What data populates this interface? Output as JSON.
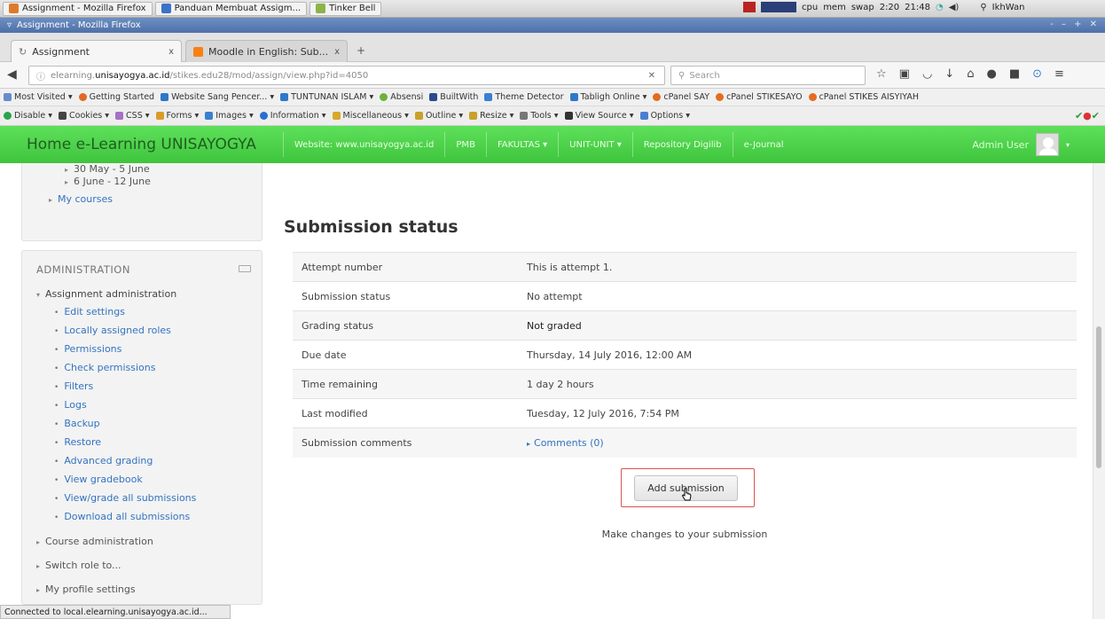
{
  "taskbar": {
    "items": [
      "Assignment - Mozilla Firefox",
      "Panduan Membuat Assigm...",
      "Tinker Bell"
    ],
    "sysinfo": [
      "cpu",
      "mem",
      "swap",
      "2:20",
      "21:48"
    ],
    "user": "IkhWan"
  },
  "window": {
    "title": "Assignment - Mozilla Firefox"
  },
  "tabs": [
    {
      "label": "Assignment",
      "active": true
    },
    {
      "label": "Moodle in English: Sub...",
      "active": false
    }
  ],
  "tab_close_glyph": "x",
  "new_tab_glyph": "+",
  "address": {
    "prefix": "elearning.",
    "domain": "unisayogya.ac.id",
    "path": "/stikes.edu28/mod/assign/view.php?id=4050",
    "search_placeholder": "Search"
  },
  "bookmarks": [
    "Most Visited",
    "Getting Started",
    "Website Sang Pencer...",
    "TUNTUNAN ISLAM",
    "Absensi",
    "BuiltWith",
    "Theme Detector",
    "Tabligh Online",
    "cPanel SAY",
    "cPanel STIKESAYO",
    "cPanel STIKES AISYIYAH"
  ],
  "devtools": [
    "Disable",
    "Cookies",
    "CSS",
    "Forms",
    "Images",
    "Information",
    "Miscellaneous",
    "Outline",
    "Resize",
    "Tools",
    "View Source",
    "Options"
  ],
  "moodle_nav": {
    "brand": "Home e-Learning UNISAYOGYA",
    "items": [
      "Website: www.unisayogya.ac.id",
      "PMB",
      "FAKULTAS",
      "UNIT-UNIT",
      "Repository Digilib",
      "e-Journal"
    ],
    "user": "Admin User"
  },
  "sidebar_top": {
    "items": [
      "30 May - 5 June",
      "6 June - 12 June",
      "My courses"
    ]
  },
  "administration": {
    "title": "ADMINISTRATION",
    "section": "Assignment administration",
    "links": [
      "Edit settings",
      "Locally assigned roles",
      "Permissions",
      "Check permissions",
      "Filters",
      "Logs",
      "Backup",
      "Restore",
      "Advanced grading",
      "View gradebook",
      "View/grade all submissions",
      "Download all submissions"
    ],
    "collapsed": [
      "Course administration",
      "Switch role to...",
      "My profile settings"
    ]
  },
  "submission": {
    "title": "Submission status",
    "rows": [
      {
        "label": "Attempt number",
        "value": "This is attempt 1."
      },
      {
        "label": "Submission status",
        "value": "No attempt"
      },
      {
        "label": "Grading status",
        "value": "Not graded"
      },
      {
        "label": "Due date",
        "value": "Thursday, 14 July 2016, 12:00 AM"
      },
      {
        "label": "Time remaining",
        "value": "1 day 2 hours"
      },
      {
        "label": "Last modified",
        "value": "Tuesday, 12 July 2016, 7:54 PM"
      },
      {
        "label": "Submission comments",
        "value": "Comments (0)"
      }
    ],
    "button": "Add submission",
    "hint": "Make changes to your submission"
  },
  "statusbar": "Connected to local.elearning.unisayogya.ac.id...",
  "colors": {
    "moodle_green": "#4fd24c",
    "link": "#3473c0",
    "highlight": "#d9534f"
  }
}
